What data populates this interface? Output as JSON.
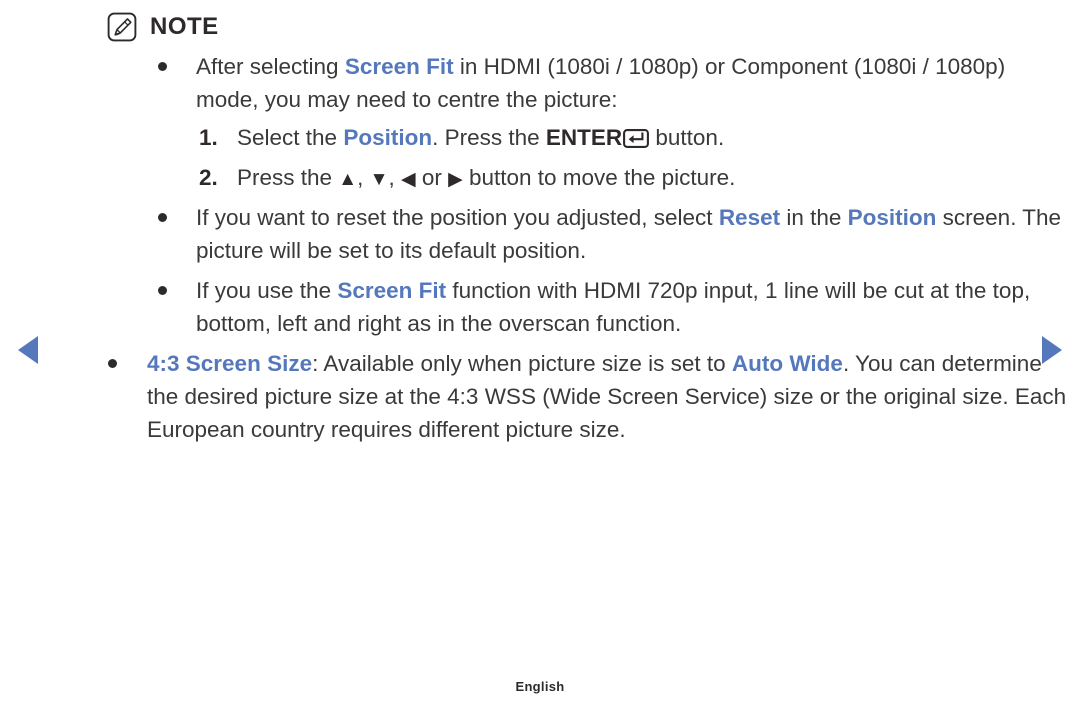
{
  "note": {
    "icon": "note-pencil-icon",
    "title": "NOTE"
  },
  "nav": {
    "prev_icon": "triangle-left-icon",
    "next_icon": "triangle-right-icon",
    "color": "#5578bd"
  },
  "colors": {
    "accent_blue": "#5578bd",
    "body_text": "#3a3a3a",
    "strong_text": "#2e2a2c",
    "background": "#ffffff"
  },
  "bullets": {
    "b1": {
      "marker": "●",
      "p1": "After selecting ",
      "hl1": "Screen Fit",
      "p2": " in HDMI (1080i / 1080p) or Component (1080i / 1080p) mode, you may need to centre the picture:"
    },
    "b2": {
      "marker": "●",
      "p1": "If you want to reset the position you adjusted, select ",
      "hl1": "Reset",
      "p2": " in the ",
      "hl2": "Position",
      "p3": " screen. The picture will be set to its default position."
    },
    "b3": {
      "marker": "●",
      "p1": "If you use the ",
      "hl1": "Screen Fit",
      "p2": " function with HDMI 720p input, 1 line will be cut at the top, bottom, left and right as in the overscan function."
    },
    "b4": {
      "marker": "●",
      "hl1": "4:3 Screen Size",
      "p1": ": Available only when picture size is set to ",
      "hl2": "Auto Wide",
      "p2": ". You can determine the desired picture size at the 4:3 WSS (Wide Screen Service) size or the original size. Each European country requires different picture size."
    }
  },
  "steps": {
    "s1": {
      "number": "1.",
      "p1": "Select the ",
      "hl1": "Position",
      "p2": ". Press the ",
      "bold1": "ENTER",
      "key_icon": "enter-key-icon",
      "p3": " button."
    },
    "s2": {
      "number": "2.",
      "p1": "Press the ",
      "t1": "▲",
      "p2": ", ",
      "t2": "▼",
      "p3": ", ",
      "t3": "◀",
      "p4": " or ",
      "t4": "▶",
      "p5": " button to move the picture."
    }
  },
  "footer": {
    "language": "English"
  }
}
